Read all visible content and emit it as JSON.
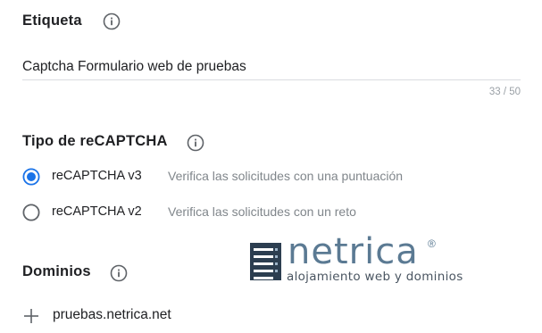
{
  "label_section": {
    "title": "Etiqueta",
    "input_value": "Captcha Formulario web de pruebas",
    "counter": "33 / 50"
  },
  "recaptcha_type_section": {
    "title": "Tipo de reCAPTCHA",
    "options": [
      {
        "label": "reCAPTCHA v3",
        "description": "Verifica las solicitudes con una puntuación",
        "selected": true
      },
      {
        "label": "reCAPTCHA v2",
        "description": "Verifica las solicitudes con un reto",
        "selected": false
      }
    ]
  },
  "domains_section": {
    "title": "Dominios",
    "domains": [
      "pruebas.netrica.net"
    ]
  },
  "watermark": {
    "brand": "netrica",
    "registered": "®",
    "tagline": "alojamiento web y dominios"
  },
  "colors": {
    "accent": "#1a73e8",
    "text_primary": "#202124",
    "text_secondary": "#80868b",
    "divider": "#dadce0",
    "watermark": "#5b7a93"
  },
  "icons": {
    "info": "info-circle-icon",
    "add": "plus-icon",
    "logo": "server-rack-icon"
  }
}
